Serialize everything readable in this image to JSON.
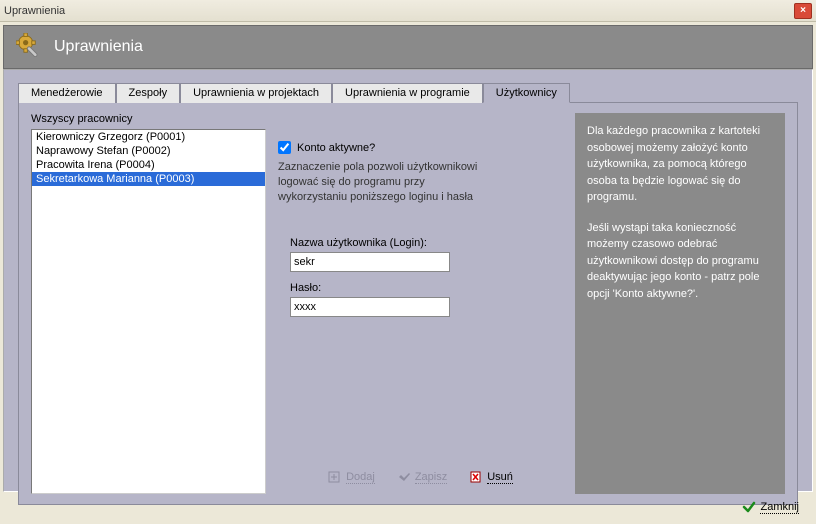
{
  "window": {
    "title": "Uprawnienia"
  },
  "header": {
    "title": "Uprawnienia"
  },
  "tabs": [
    {
      "label": "Menedżerowie"
    },
    {
      "label": "Zespoły"
    },
    {
      "label": "Uprawnienia w projektach"
    },
    {
      "label": "Uprawnienia w programie"
    },
    {
      "label": "Użytkownicy"
    }
  ],
  "employees": {
    "heading": "Wszyscy pracownicy",
    "items": [
      {
        "label": "Kierowniczy Grzegorz (P0001)"
      },
      {
        "label": "Naprawowy Stefan (P0002)"
      },
      {
        "label": "Pracowita Irena (P0004)"
      },
      {
        "label": "Sekretarkowa Marianna (P0003)"
      }
    ],
    "selected_index": 3
  },
  "account": {
    "checkbox_label": "Konto aktywne?",
    "checked": true,
    "description": "Zaznaczenie pola pozwoli użytkownikowi logować się do programu przy wykorzystaniu poniższego loginu i hasła",
    "login_label": "Nazwa użytkownika (Login):",
    "login_value": "sekr",
    "password_label": "Hasło:",
    "password_value": "xxxx"
  },
  "actions": {
    "add": "Dodaj",
    "save": "Zapisz",
    "delete": "Usuń"
  },
  "help": {
    "p1": "Dla każdego pracownika z kartoteki osobowej możemy założyć konto użytkownika, za pomocą którego osoba ta będzie logować się do programu.",
    "p2": "Jeśli wystąpi taka konieczność możemy czasowo odebrać użytkownikowi dostęp do programu deaktywując jego konto - patrz pole opcji 'Konto aktywne?'."
  },
  "footer": {
    "close": "Zamknij"
  }
}
